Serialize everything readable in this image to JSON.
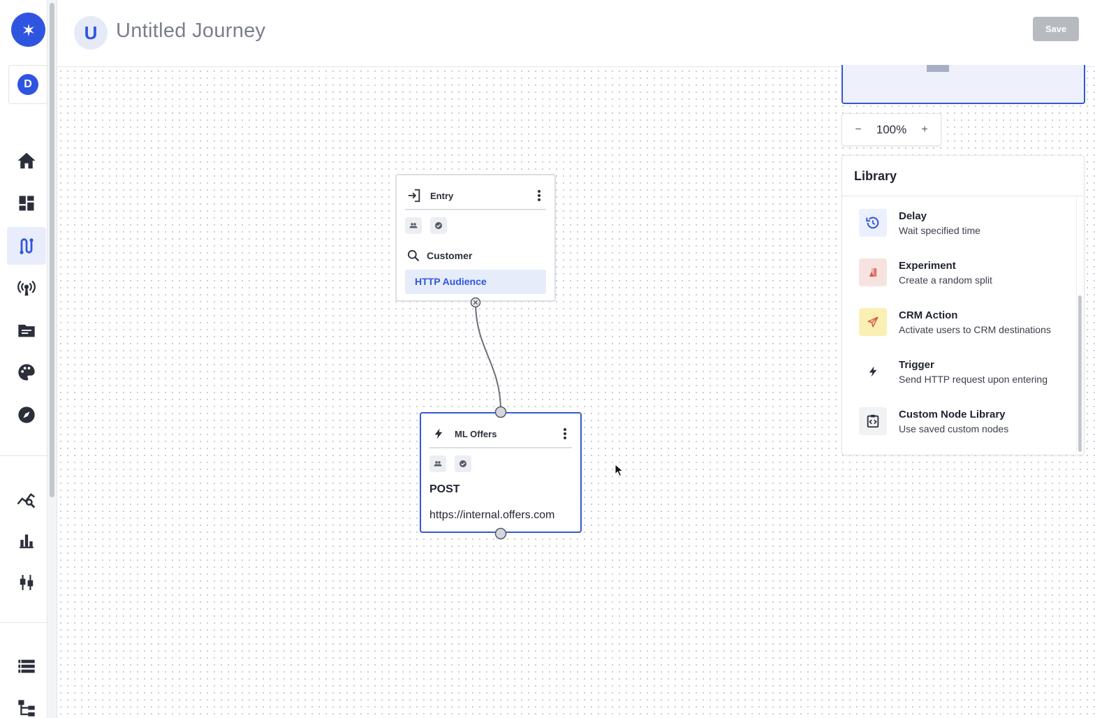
{
  "app": {
    "workspace_initial": "D"
  },
  "header": {
    "avatar_letter": "U",
    "title": "Untitled Journey",
    "save_label": "Save"
  },
  "sidebar": {
    "items": [
      {
        "name": "home",
        "icon": "home-icon",
        "active": false
      },
      {
        "name": "dashboard",
        "icon": "dashboard-icon",
        "active": false
      },
      {
        "name": "journeys",
        "icon": "journey-icon",
        "active": true
      },
      {
        "name": "broadcast",
        "icon": "broadcast-icon",
        "active": false
      },
      {
        "name": "folder",
        "icon": "folder-icon",
        "active": false
      },
      {
        "name": "palette",
        "icon": "palette-icon",
        "active": false
      },
      {
        "name": "explore",
        "icon": "compass-icon",
        "active": false
      },
      {
        "name": "analytics",
        "icon": "analytics-icon",
        "active": false
      },
      {
        "name": "reports",
        "icon": "bar-chart-icon",
        "active": false
      },
      {
        "name": "settings",
        "icon": "sliders-icon",
        "active": false
      },
      {
        "name": "list",
        "icon": "list-icon",
        "active": false
      },
      {
        "name": "hierarchy",
        "icon": "hierarchy-icon",
        "active": false
      }
    ]
  },
  "canvas": {
    "entry_node": {
      "title": "Entry",
      "source_label": "Customer",
      "audience": "HTTP Audience"
    },
    "ml_node": {
      "title": "ML Offers",
      "method": "POST",
      "url": "https://internal.offers.com"
    }
  },
  "zoom": {
    "value": "100%",
    "minus": "−",
    "plus": "+"
  },
  "library": {
    "title": "Library",
    "items": [
      {
        "name": "Delay",
        "desc": "Wait specified time",
        "icon": "history-icon",
        "color": "#eaf0fd"
      },
      {
        "name": "Experiment",
        "desc": "Create a random split",
        "icon": "flask-icon",
        "color": "#f6e3e0"
      },
      {
        "name": "CRM Action",
        "desc": "Activate users to CRM destinations",
        "icon": "send-icon",
        "color": "#fbf0b3"
      },
      {
        "name": "Trigger",
        "desc": "Send HTTP request upon entering",
        "icon": "bolt-icon",
        "color": "#ffffff"
      },
      {
        "name": "Custom Node Library",
        "desc": "Use saved custom nodes",
        "icon": "custom-node-icon",
        "color": "#f1f2f4"
      }
    ]
  },
  "colors": {
    "accent": "#2f55e0",
    "selected_border": "#3457d5",
    "save_disabled": "#b7babf"
  }
}
